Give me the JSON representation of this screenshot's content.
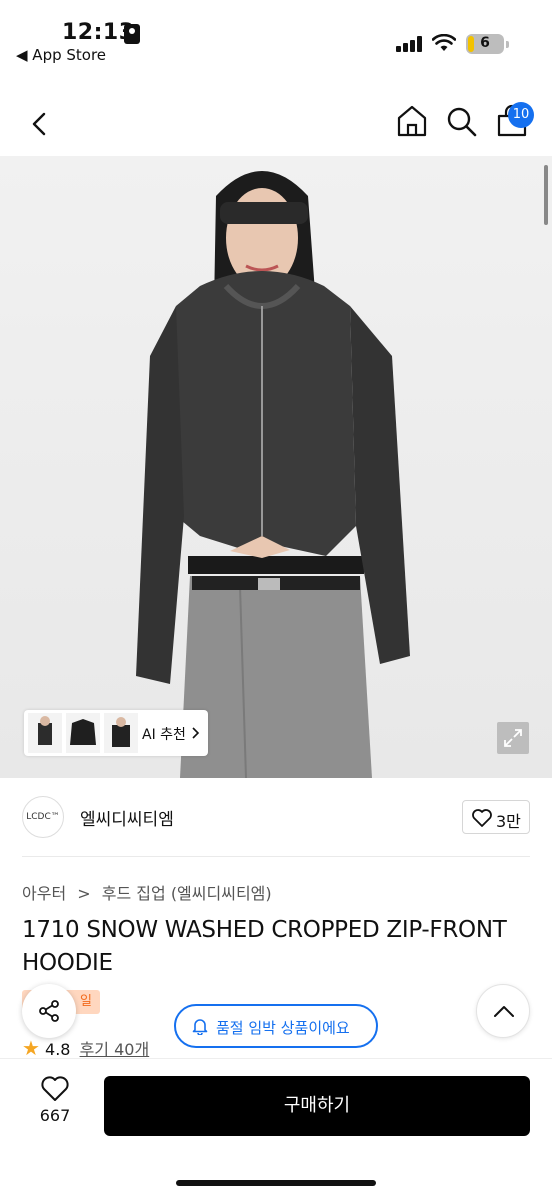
{
  "status_bar": {
    "time": "12:13",
    "back_app": "◀ App Store",
    "battery": "6"
  },
  "nav": {
    "back_icon": "chevron-left-icon",
    "home_icon": "home-icon",
    "search_icon": "search-icon",
    "cart_icon": "shopping-bag-icon",
    "cart_count": "10"
  },
  "product_image": {
    "ai_recommend_label": "AI 추천",
    "expand_icon": "expand-icon"
  },
  "brand": {
    "logo_text": "LCDC™",
    "name": "엘씨디씨티엠",
    "likes": "3만"
  },
  "breadcrumb": {
    "items": [
      "아우터",
      ">",
      "후드 집업 (엘씨디씨티엠)"
    ]
  },
  "product": {
    "title": "1710 SNOW WASHED CROPPED ZIP-FRONT HOODIE",
    "tag": "일",
    "rating": "4.8",
    "reviews": "후기 40개"
  },
  "alert": {
    "text": "품절 임박 상품이에요"
  },
  "bottom": {
    "wish_count": "667",
    "buy_label": "구매하기"
  },
  "colors": {
    "accent": "#1570ef",
    "tag_bg": "#ffd7bf",
    "tag_text": "#f26b1d",
    "star": "#f5a623",
    "buy_button": "#000000"
  }
}
